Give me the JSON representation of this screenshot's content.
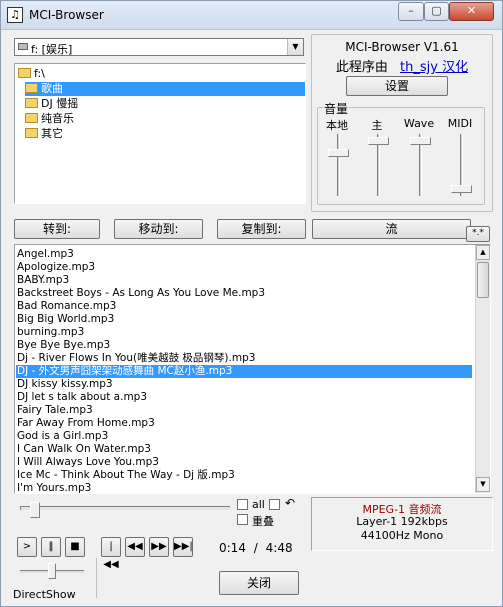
{
  "window": {
    "title": "MCI-Browser",
    "app_icon": "music-note-icon",
    "controls": [
      "minimize-icon",
      "maximize-icon",
      "close-icon"
    ]
  },
  "drive": {
    "selected": "f: [娱乐]"
  },
  "tree": {
    "items": [
      {
        "label": "f:\\",
        "level": 0
      },
      {
        "label": "歌曲",
        "level": 1,
        "selected": true
      },
      {
        "label": "DJ 慢摇",
        "level": 1
      },
      {
        "label": "纯音乐",
        "level": 1
      },
      {
        "label": "其它",
        "level": 1
      }
    ]
  },
  "about": {
    "version": "MCI-Browser V1.61",
    "credit_prefix": "此程序由",
    "credit_link": "th_sjy 汉化",
    "settings_label": "设置"
  },
  "volume": {
    "title": "音量",
    "channels": [
      {
        "label": "本地",
        "level": 0.72
      },
      {
        "label": "主",
        "level": 0.95
      },
      {
        "label": "Wave",
        "level": 0.95
      },
      {
        "label": "MIDI",
        "level": 0.05
      }
    ]
  },
  "actions": {
    "goto_label": "转到:",
    "move_label": "移动到:",
    "copy_label": "复制到:",
    "stream_label": "流",
    "mask_label": "*.*"
  },
  "files": [
    "Angel.mp3",
    "Apologize.mp3",
    "BABY.mp3",
    "Backstreet Boys - As Long As You Love Me.mp3",
    "Bad Romance.mp3",
    "Big Big World.mp3",
    "burning.mp3",
    "Bye Bye Bye.mp3",
    "Dj - River Flows In You(唯美越鼓 极品钢琴).mp3",
    "DJ - 外文男声囧架架动感舞曲 MC赵小渔.mp3",
    "DJ kissy kissy.mp3",
    "DJ let s talk about a.mp3",
    "Fairy Tale.mp3",
    "Far Away From Home.mp3",
    "God is a Girl.mp3",
    "I Can Walk On Water.mp3",
    "I Will Always Love You.mp3",
    "Ice Mc - Think About The Way - Dj 版.mp3",
    "I'm Yours.mp3"
  ],
  "selected_file_index": 9,
  "playback": {
    "position_fraction": 0.05,
    "all_label": "all",
    "repeat_label": "重叠",
    "current_time": "0:14",
    "separator": "/",
    "total_time": "4:48",
    "volume_level": 0.5,
    "engine": "DirectShow",
    "close_label": "关闭"
  },
  "format": {
    "codec": "MPEG-1 音频流",
    "layer": "Layer-1  192kbps",
    "rate": "44100Hz  Mono"
  }
}
